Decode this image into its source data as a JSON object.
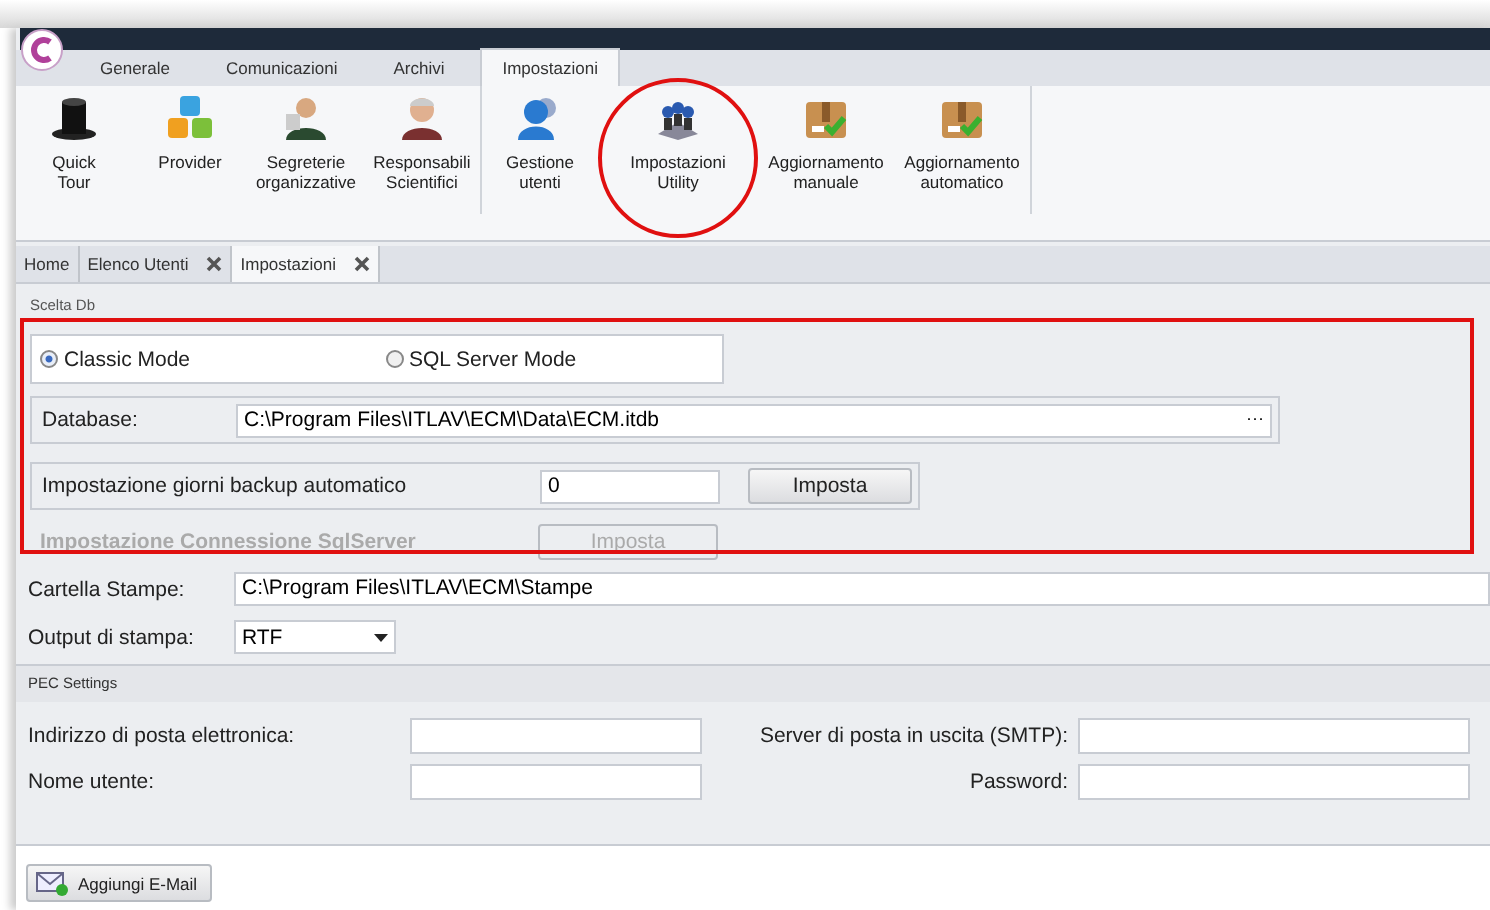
{
  "ribbon_tabs": [
    {
      "label": "Generale",
      "selected": false
    },
    {
      "label": "Comunicazioni",
      "selected": false
    },
    {
      "label": "Archivi",
      "selected": false
    },
    {
      "label": "Impostazioni",
      "selected": true
    }
  ],
  "ribbon_groups": [
    {
      "buttons": [
        {
          "kind": "hat",
          "lines": [
            "Quick",
            "Tour"
          ]
        },
        {
          "kind": "blocks",
          "lines": [
            "Provider"
          ]
        },
        {
          "kind": "person",
          "lines": [
            "Segreterie",
            "organizzative"
          ]
        },
        {
          "kind": "elder",
          "lines": [
            "Responsabili",
            "Scientifici"
          ]
        }
      ]
    },
    {
      "buttons": [
        {
          "kind": "users",
          "lines": [
            "Gestione",
            "utenti"
          ]
        },
        {
          "kind": "team",
          "lines": [
            "Impostazioni",
            "Utility"
          ]
        },
        {
          "kind": "package",
          "lines": [
            "Aggiornamento",
            "manuale"
          ]
        },
        {
          "kind": "package",
          "lines": [
            "Aggiornamento",
            "automatico"
          ]
        }
      ]
    }
  ],
  "doc_tabs": [
    {
      "label": "Home",
      "closable": false,
      "selected": false
    },
    {
      "label": "Elenco Utenti",
      "closable": true,
      "selected": false
    },
    {
      "label": "Impostazioni",
      "closable": true,
      "selected": true
    }
  ],
  "scelta_db": {
    "title": "Scelta Db",
    "modes": [
      {
        "label": "Classic Mode",
        "selected": true
      },
      {
        "label": "SQL Server Mode",
        "selected": false
      }
    ],
    "database": {
      "label": "Database:",
      "value": "C:\\Program Files\\ITLAV\\ECM\\Data\\ECM.itdb",
      "browse": "···"
    },
    "backup": {
      "label": "Impostazione giorni backup automatico",
      "value": "0",
      "button": "Imposta"
    },
    "sql": {
      "label": "Impostazione Connessione SqlServer",
      "button": "Imposta",
      "disabled": true
    }
  },
  "cartella": {
    "label": "Cartella Stampe:",
    "value": "C:\\Program Files\\ITLAV\\ECM\\Stampe"
  },
  "output": {
    "label": "Output di stampa:",
    "value": "RTF"
  },
  "pec": {
    "title": "PEC Settings",
    "rows": [
      [
        {
          "label": "Indirizzo di posta elettronica:"
        },
        {
          "label": "Server di posta in uscita (SMTP):"
        }
      ],
      [
        {
          "label": "Nome utente:"
        },
        {
          "label": "Password:"
        }
      ]
    ]
  },
  "add_button": "Aggiungi E-Mail"
}
